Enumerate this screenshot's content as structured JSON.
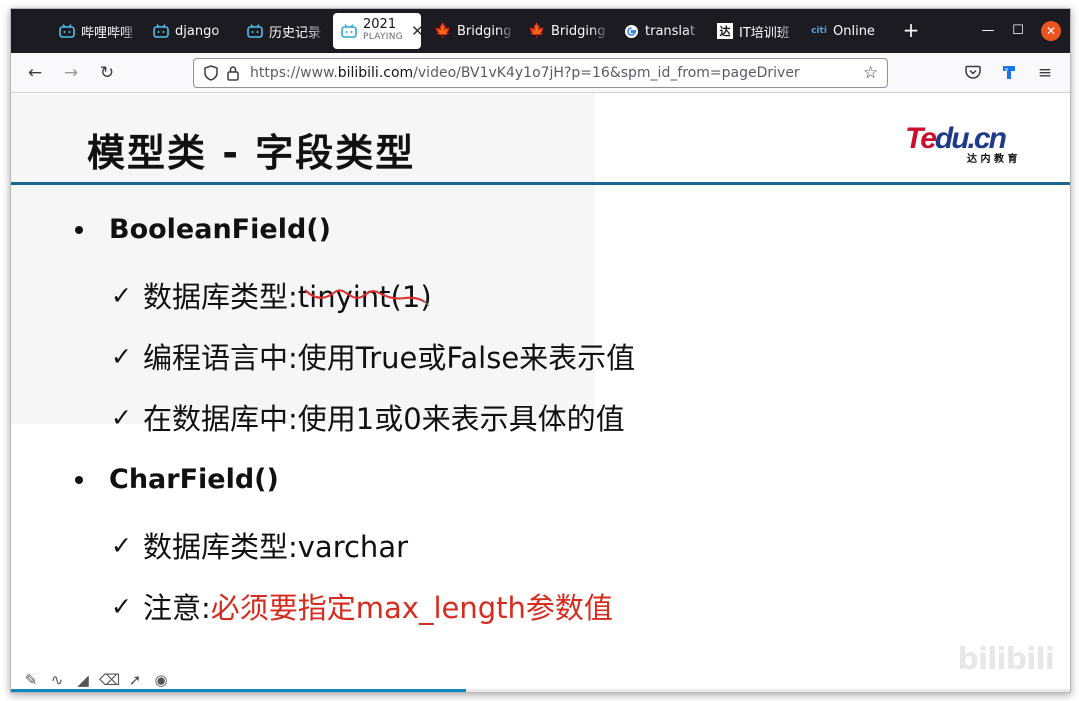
{
  "browser": {
    "tabs": [
      {
        "label": "哔哩哔哩",
        "icon": "bilibili-tv-icon",
        "active": false
      },
      {
        "label": "django",
        "icon": "bilibili-tv-icon",
        "active": false
      },
      {
        "label": "历史记录",
        "icon": "bilibili-tv-icon",
        "active": false
      },
      {
        "label": "2021",
        "sub": "PLAYING",
        "icon": "bilibili-tv-icon",
        "active": true
      },
      {
        "label": "Bridging",
        "icon": "maple-leaf-icon",
        "active": false
      },
      {
        "label": "Bridging",
        "icon": "maple-leaf-icon",
        "active": false
      },
      {
        "label": "translat",
        "icon": "google-icon",
        "active": false
      },
      {
        "label": "IT培训班",
        "icon": "da-logo-icon",
        "active": false
      },
      {
        "label": "Online",
        "icon": "citi-icon",
        "active": false
      }
    ],
    "new_tab_symbol": "+",
    "window_controls": {
      "minimize": "—",
      "maximize": "☐",
      "close": "✕"
    },
    "url": {
      "prefix": "https://www.",
      "domain": "bilibili.com",
      "path": "/video/BV1vK4y1o7jH?p=16&spm_id_from=pageDriver"
    },
    "accent_colors": {
      "tabbar": "#1c1b22",
      "close_button": "#e95420",
      "progress": "#0c8ab7"
    }
  },
  "slide": {
    "title": "模型类 - 字段类型",
    "logo": {
      "brand": "Tedu.cn",
      "subtitle": "达 内 教 育"
    },
    "sections": [
      {
        "heading": "BooleanField()",
        "items": [
          {
            "check": "✓",
            "text": "数据库类型:tinyint(1)",
            "red": ""
          },
          {
            "check": "✓",
            "text": "编程语言中:使用True或False来表示值",
            "red": ""
          },
          {
            "check": "✓",
            "text": "在数据库中:使用1或0来表示具体的值",
            "red": ""
          }
        ]
      },
      {
        "heading": "CharField()",
        "items": [
          {
            "check": "✓",
            "text": "数据库类型:varchar",
            "red": ""
          },
          {
            "check": "✓",
            "text": "注意: ",
            "red": "必须要指定max_length参数值"
          }
        ]
      }
    ],
    "watermark": "bilibili",
    "video_progress_percent": 43
  }
}
